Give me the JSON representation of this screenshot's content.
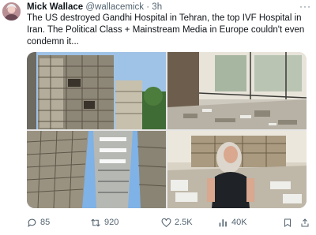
{
  "tweet": {
    "author_name": "Mick Wallace",
    "handle": "@wallacemick",
    "separator": "·",
    "time": "3h",
    "more_label": "···",
    "text": "The US destroyed Gandhi Hospital in Tehran, the top IVF Hospital in Iran. The Political Class + Mainstream Media in Europe couldn't even condemn it..."
  },
  "media": [
    {
      "subject": "damaged hospital facade with scaffolding"
    },
    {
      "subject": "rubble-filled interior with shattered windows"
    },
    {
      "subject": "building exterior with scaffolding seen from below"
    },
    {
      "subject": "man standing in debris-covered room"
    }
  ],
  "actions": {
    "replies": "85",
    "reposts": "920",
    "likes": "2.5K",
    "views": "40K"
  },
  "icons": {
    "reply": "reply-icon",
    "repost": "repost-icon",
    "like": "heart-icon",
    "views": "views-icon",
    "bookmark": "bookmark-icon",
    "share": "share-icon"
  },
  "colors": {
    "text": "#0f1419",
    "secondary": "#536471"
  }
}
